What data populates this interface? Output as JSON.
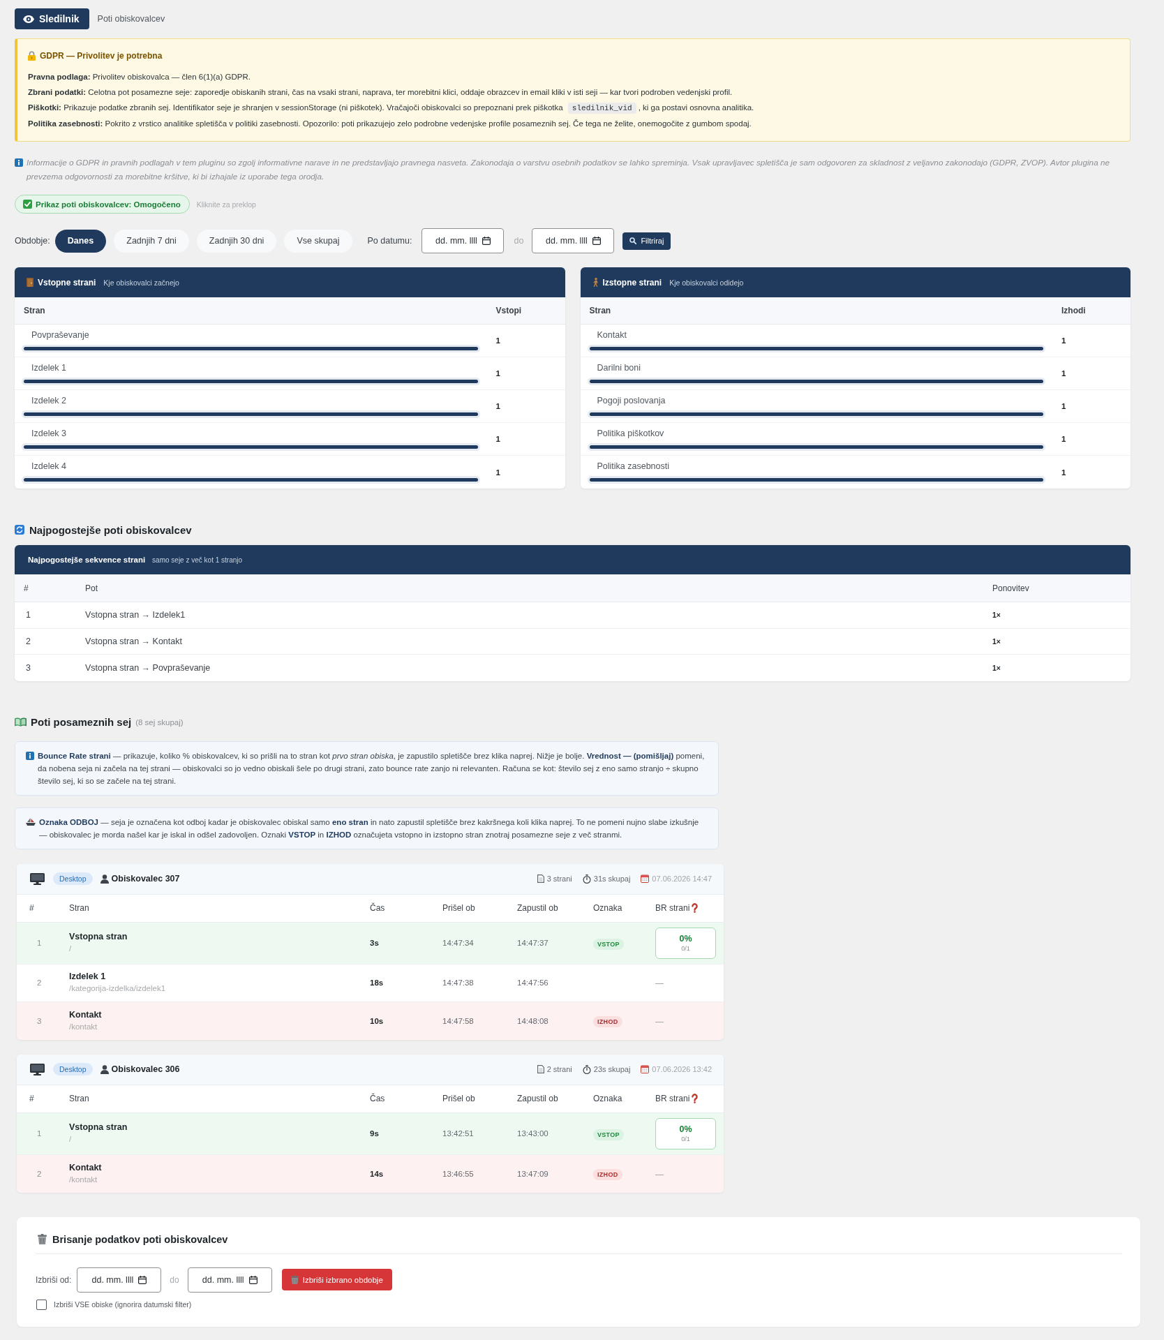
{
  "header": {
    "brand": "Sledilnik",
    "subtitle": "Poti obiskovalcev"
  },
  "gdpr_notice": {
    "title": "GDPR — Privolitev je potrebna",
    "lines": [
      {
        "text": "**Pravna podlaga:** Privolitev obiskovalca — člen 6(1)(a) GDPR."
      },
      {
        "text": "**Zbrani podatki:** Celotna pot posamezne seje: zaporedje obiskanih strani, čas na vsaki strani, naprava, ter morebitni klici, oddaje obrazcev in email kliki v isti seji — kar tvori podroben vedenjski profil."
      },
      {
        "text": "**Piškotki:** Prikazuje podatke zbranih sej. Identifikator seje je shranjen v sessionStorage (ni piškotek). Vračajoči obiskovalci so prepoznani prek piškotka",
        "code": "sledilnik_vid",
        "text_after": ", ki ga postavi osnovna analitika."
      },
      {
        "text": "**Politika zasebnosti:** Pokrito z vrstico analitike spletišča v politiki zasebnosti. Opozorilo: poti prikazujejo zelo podrobne vedenjske profile posameznih sej. Če tega ne želite, onemogočite z gumbom spodaj."
      }
    ]
  },
  "disclaimer": "Informacije o GDPR in pravnih podlagah v tem pluginu so zgolj informativne narave in ne predstavljajo pravnega nasveta. Zakonodaja o varstvu osebnih podatkov se lahko spreminja. Vsak upravljavec spletišča je sam odgovoren za skladnost z veljavno zakonodajo (GDPR, ZVOP). Avtor plugina ne prevzema odgovornosti za morebitne kršitve, ki bi izhajale iz uporabe tega orodja.",
  "tracking_toggle": {
    "label": "Prikaz poti obiskovalcev: Omogočeno",
    "on": true,
    "hint": "Kliknite za preklop"
  },
  "filters": {
    "label": "Obdobje:",
    "periods": [
      {
        "label": "Danes",
        "selected": true
      },
      {
        "label": "Zadnjih 7 dni",
        "selected": false
      },
      {
        "label": "Zadnjih 30 dni",
        "selected": false
      },
      {
        "label": "Vse skupaj",
        "selected": false
      }
    ],
    "date_label": "Po datumu:",
    "date_from": {
      "placeholder": "dd. mm. llll"
    },
    "separator": "do",
    "date_to": {
      "placeholder": "dd. mm. llll"
    },
    "button": "Filtriraj"
  },
  "entry_pages": {
    "title": "Vstopne strani",
    "subtitle": "Kje obiskovalci začnejo",
    "columns": [
      "Stran",
      "Vstopi"
    ],
    "rows": [
      {
        "page": "Povpraševanje",
        "count": "1",
        "level": 1
      },
      {
        "page": "Izdelek 1",
        "count": "1",
        "level": 1
      },
      {
        "page": "Izdelek 2",
        "count": "1",
        "level": 1
      },
      {
        "page": "Izdelek 3",
        "count": "1",
        "level": 1
      },
      {
        "page": "Izdelek 4",
        "count": "1",
        "level": 1
      }
    ]
  },
  "exit_pages": {
    "title": "Izstopne strani",
    "subtitle": "Kje obiskovalci odidejo",
    "columns": [
      "Stran",
      "Izhodi"
    ],
    "rows": [
      {
        "page": "Kontakt",
        "count": "1",
        "level": 1
      },
      {
        "page": "Darilni boni",
        "count": "1",
        "level": 1
      },
      {
        "page": "Pogoji poslovanja",
        "count": "1",
        "level": 1
      },
      {
        "page": "Politika piškotkov",
        "count": "1",
        "level": 1
      },
      {
        "page": "Politika zasebnosti",
        "count": "1",
        "level": 1
      }
    ]
  },
  "top_paths": {
    "heading": "Najpogostejše poti obiskovalcev",
    "title": "Najpogostejše sekvence strani",
    "subtitle": "samo seje z več kot 1 stranjo",
    "columns": [
      "#",
      "Pot",
      "Ponovitev"
    ],
    "rows": [
      {
        "index": "1",
        "path": "Vstopna stran → Izdelek1",
        "count": "1×"
      },
      {
        "index": "2",
        "path": "Vstopna stran → Kontakt",
        "count": "1×"
      },
      {
        "index": "3",
        "path": "Vstopna stran → Povpraševanje",
        "count": "1×"
      }
    ]
  },
  "sessions": {
    "heading": "Poti posameznih sej",
    "count": "(8 sej skupaj)",
    "notes": [
      {
        "text": "**Bounce Rate strani** — prikazuje, koliko % obiskovalcev, ki so prišli na to stran kot *prvo stran obiska*, je zapustilo spletišče brez klika naprej. Nižje je bolje. **Vrednost — (pomišljaj)** pomeni, da nobena seja ni začela na tej strani — obiskovalci so jo vedno obiskali šele po drugi strani, zato bounce rate zanjo ni relevanten. Računa se kot: število sej z eno samo stranjo ÷ skupno število sej, ki so se začele na tej strani."
      },
      {
        "text": "**Oznaka ODBOJ** — seja je označena kot odboj kadar je obiskovalec obiskal samo **eno stran** in nato zapustil spletišče brez kakršnega koli klika naprej. To ne pomeni nujno slabe izkušnje — obiskovalec je morda našel kar je iskal in odšel zadovoljen. Oznaki **VSTOP** in **IZHOD** označujeta vstopno in izstopno stran znotraj posamezne seje z več stranmi."
      }
    ],
    "visits": [
      {
        "device": "Desktop",
        "visitor": "Obiskovalec 307",
        "pages": "3 strani",
        "duration": "31s skupaj",
        "date": "07.06.2026 14:47",
        "columns": [
          "#",
          "Stran",
          "Čas",
          "Prišel ob",
          "Zapustil ob",
          "Oznaka",
          "BR strani"
        ],
        "rows": [
          {
            "kind": "entry",
            "index": "1",
            "title": "Vstopna stran",
            "path": "/",
            "time": "3s",
            "arrived": "14:47:34",
            "left": "14:47:37",
            "tag": "VSTOP",
            "br": {
              "kind": "box",
              "value": "0%",
              "ratio": "0/1"
            }
          },
          {
            "kind": "middle",
            "index": "2",
            "title": "Izdelek 1",
            "path": "/kategorija-izdelka/izdelek1",
            "time": "18s",
            "arrived": "14:47:38",
            "left": "14:47:56",
            "br": {
              "kind": "none",
              "value": "—"
            }
          },
          {
            "kind": "exit",
            "index": "3",
            "title": "Kontakt",
            "path": "/kontakt",
            "time": "10s",
            "arrived": "14:47:58",
            "left": "14:48:08",
            "tag": "IZHOD",
            "br": {
              "kind": "none",
              "value": "—"
            }
          }
        ]
      },
      {
        "device": "Desktop",
        "visitor": "Obiskovalec 306",
        "pages": "2 strani",
        "duration": "23s skupaj",
        "date": "07.06.2026 13:42",
        "columns": [
          "#",
          "Stran",
          "Čas",
          "Prišel ob",
          "Zapustil ob",
          "Oznaka",
          "BR strani"
        ],
        "rows": [
          {
            "kind": "entry",
            "index": "1",
            "title": "Vstopna stran",
            "path": "/",
            "time": "9s",
            "arrived": "13:42:51",
            "left": "13:43:00",
            "tag": "VSTOP",
            "br": {
              "kind": "box",
              "value": "0%",
              "ratio": "0/1"
            }
          },
          {
            "kind": "exit",
            "index": "2",
            "title": "Kontakt",
            "path": "/kontakt",
            "time": "14s",
            "arrived": "13:46:55",
            "left": "13:47:09",
            "tag": "IZHOD",
            "br": {
              "kind": "none",
              "value": "—"
            }
          }
        ]
      }
    ]
  },
  "delete_data": {
    "title": "Brisanje podatkov poti obiskovalcev",
    "from_label": "Izbriši od:",
    "date_from": {
      "placeholder": "dd. mm. llll"
    },
    "separator": "do",
    "date_to": {
      "placeholder": "dd. mm. llll"
    },
    "button": "Izbriši izbrano obdobje",
    "delete_all": {
      "label": "Izbriši VSE obiske (ignorira datumski filter)",
      "checked": false
    }
  }
}
